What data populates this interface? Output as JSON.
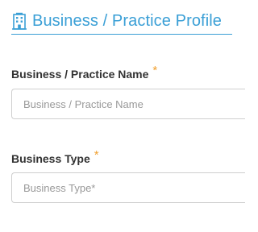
{
  "header": {
    "title": "Business / Practice Profile",
    "icon": "building-icon",
    "accent_color": "#3a9fd6"
  },
  "fields": [
    {
      "label": "Business / Practice Name",
      "required_marker": "*",
      "value": "",
      "placeholder": "Business / Practice Name"
    },
    {
      "label": "Business Type",
      "required_marker": "*",
      "value": "",
      "placeholder": "Business Type*"
    }
  ],
  "colors": {
    "required_marker": "#f0a030",
    "label": "#333333",
    "input_border": "#cfcfcf",
    "placeholder": "#999999"
  }
}
